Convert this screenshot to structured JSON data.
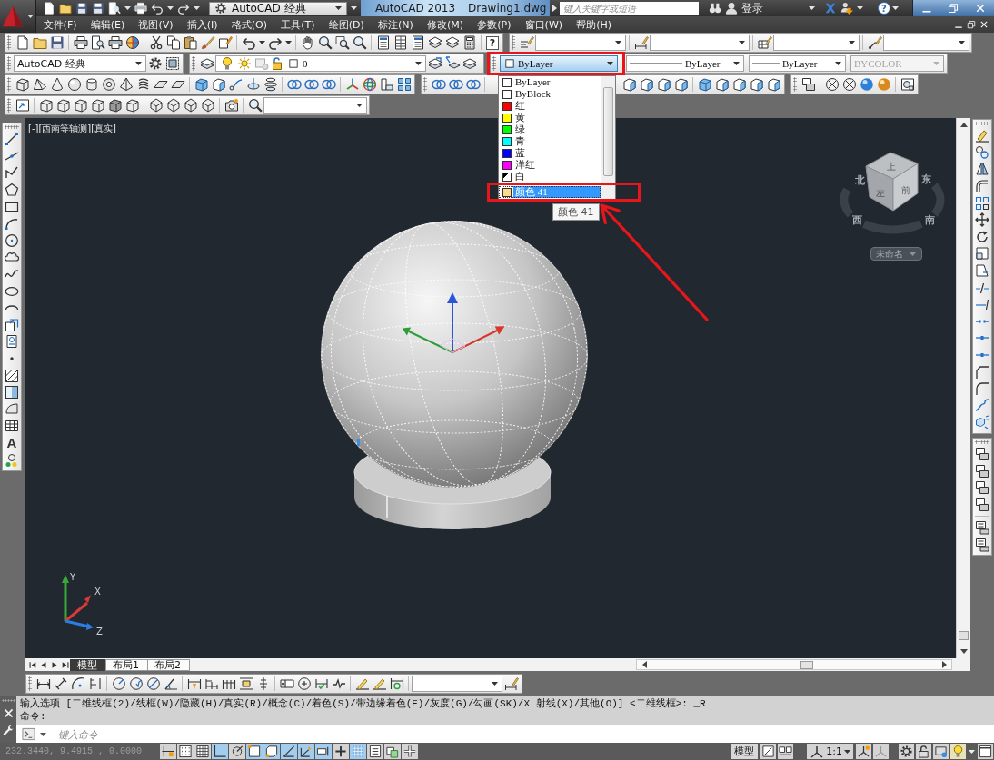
{
  "title_bar": {
    "workspace": "AutoCAD 经典",
    "app_name": "AutoCAD 2013",
    "file_name": "Drawing1.dwg",
    "search": {
      "placeholder": "键入关键字或短语"
    },
    "sign_in": "登录",
    "help": "?"
  },
  "menu_bar": [
    "文件(F)",
    "编辑(E)",
    "视图(V)",
    "插入(I)",
    "格式(O)",
    "工具(T)",
    "绘图(D)",
    "标注(N)",
    "修改(M)",
    "参数(P)",
    "窗口(W)",
    "帮助(H)"
  ],
  "toolbars": {
    "help": "?",
    "workspace": "AutoCAD 经典",
    "layer": "0",
    "color": {
      "value": "ByLayer",
      "expanded": true
    },
    "linetype": "ByLayer",
    "lineweight": "ByLayer",
    "plot_style": {
      "value": "BYCOLOR",
      "disabled": true
    }
  },
  "color_list": {
    "items": [
      {
        "label": "ByLayer",
        "kind": "swatch",
        "color": "#ffffff",
        "selected": false
      },
      {
        "label": "ByBlock",
        "kind": "swatch",
        "color": "#ffffff",
        "selected": false
      },
      {
        "label": "红",
        "kind": "swatch",
        "color": "#ff0000",
        "selected": false
      },
      {
        "label": "黄",
        "kind": "swatch",
        "color": "#ffff00",
        "selected": false
      },
      {
        "label": "绿",
        "kind": "swatch",
        "color": "#00ff00",
        "selected": false
      },
      {
        "label": "青",
        "kind": "swatch",
        "color": "#00ffff",
        "selected": false
      },
      {
        "label": "蓝",
        "kind": "swatch",
        "color": "#0000ff",
        "selected": false
      },
      {
        "label": "洋红",
        "kind": "swatch",
        "color": "#ff00ff",
        "selected": false
      },
      {
        "label": "白",
        "kind": "split",
        "color": "#ffffff",
        "selected": false
      },
      {
        "label": "颜色 41",
        "kind": "swatch",
        "color": "#ffd98c",
        "selected": true
      }
    ],
    "tooltip": "颜色 41"
  },
  "left_toolbar": {
    "text_tool": "A"
  },
  "viewport": {
    "label": "[-][西南等轴测][真实]",
    "viewcube": {
      "top": "上",
      "left": "左",
      "right": "前",
      "compass": [
        "北",
        "东",
        "西",
        "南"
      ],
      "view_menu": "未命名"
    },
    "ucs": {
      "x": "X",
      "y": "Y",
      "z": "Z"
    }
  },
  "layout_tabs": [
    {
      "label": "模型",
      "selected": true
    },
    {
      "label": "布局1",
      "selected": false
    },
    {
      "label": "布局2",
      "selected": false
    }
  ],
  "command_line": {
    "history": [
      "输入选项 [二维线框(2)/线框(W)/隐藏(H)/真实(R)/概念(C)/着色(S)/带边缘着色(E)/灰度(G)/勾画(SK)/X 射线(X)/其他(O)] <二维线框>: _R",
      "命令:"
    ],
    "input": {
      "placeholder": "键入命令"
    }
  },
  "status_bar": {
    "coordinates": "232.3440, 9.4915 , 0.0000",
    "toggles": [
      {
        "on": false
      },
      {
        "on": false
      },
      {
        "on": false
      },
      {
        "on": true
      },
      {
        "on": false
      },
      {
        "on": true
      },
      {
        "on": true
      },
      {
        "on": true
      },
      {
        "on": true
      },
      {
        "on": true
      },
      {
        "on": false
      },
      {
        "on": true
      },
      {
        "on": false
      },
      {
        "on": false
      },
      {
        "on": false
      }
    ],
    "space": "模型",
    "annotation_scale": "1:1"
  }
}
